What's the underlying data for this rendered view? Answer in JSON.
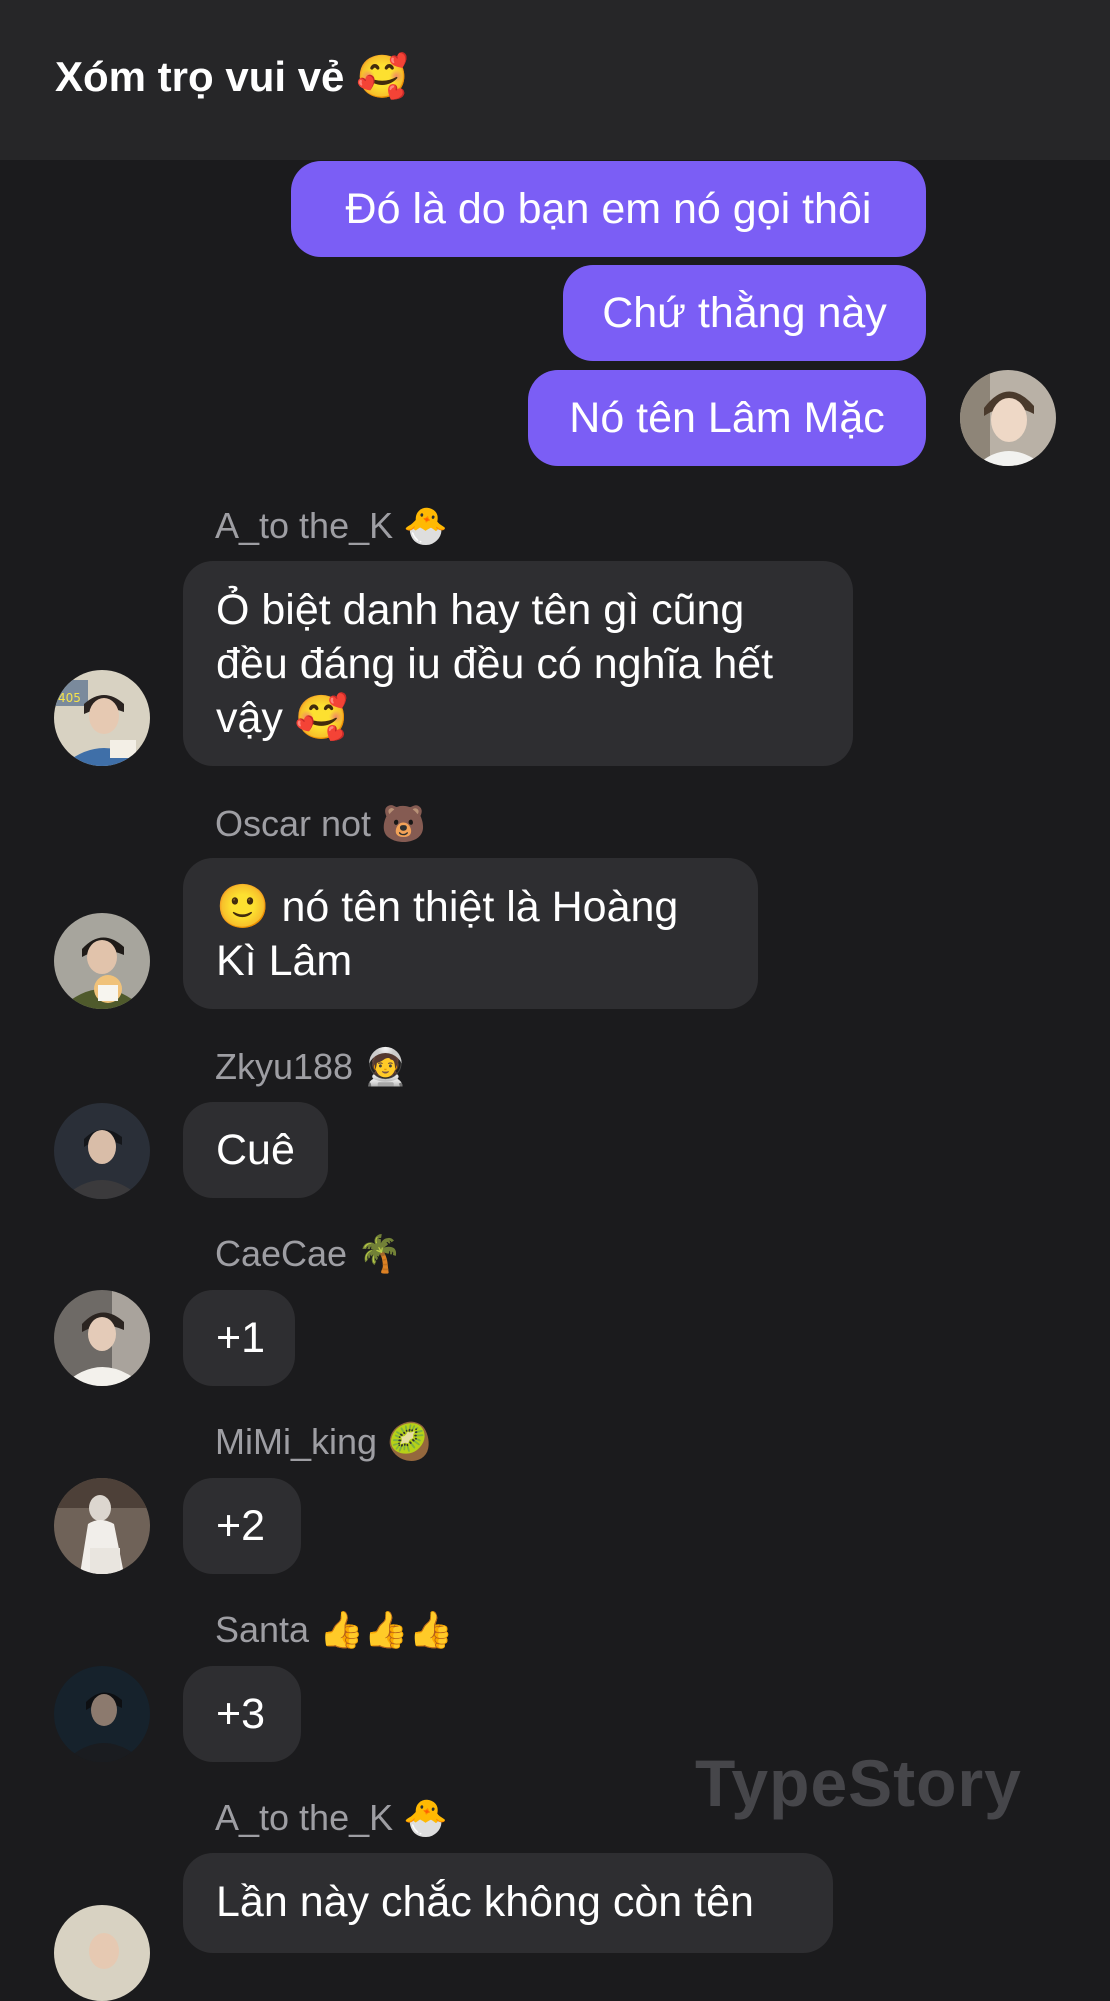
{
  "header": {
    "title": "Xóm trọ vui vẻ",
    "title_emoji": "🥰"
  },
  "outgoing": [
    {
      "text": "Đó là do bạn em nó gọi thôi"
    },
    {
      "text": "Chứ thằng này"
    },
    {
      "text": "Nó tên Lâm Mặc"
    }
  ],
  "incoming": [
    {
      "sender": "A_to the_K",
      "sender_emoji": "🐣",
      "lines": [
        "Ỏ biệt danh hay tên gì cũng",
        "đều đáng iu đều có nghĩa hết",
        "vậy 🥰"
      ]
    },
    {
      "sender": "Oscar not",
      "sender_emoji": "🐻",
      "lines": [
        "🙂 nó tên thiệt là Hoàng",
        "Kì Lâm"
      ]
    },
    {
      "sender": "Zkyu188",
      "sender_emoji": "🧑‍🚀",
      "lines": [
        "Cuê"
      ]
    },
    {
      "sender": "CaeCae",
      "sender_emoji": "🌴",
      "lines": [
        "+1"
      ]
    },
    {
      "sender": "MiMi_king",
      "sender_emoji": "🥝",
      "lines": [
        "+2"
      ]
    },
    {
      "sender": "Santa",
      "sender_emoji": "👍👍👍",
      "lines": [
        "+3"
      ]
    },
    {
      "sender": "A_to the_K",
      "sender_emoji": "🐣",
      "lines": [
        "Lần này chắc không còn tên"
      ]
    }
  ],
  "watermark": "TypeStory",
  "colors": {
    "background": "#1b1b1d",
    "header": "#262628",
    "outgoing_bubble": "#7b5ef5",
    "incoming_bubble": "#2e2e31",
    "sender_name": "#9e9ea3"
  }
}
